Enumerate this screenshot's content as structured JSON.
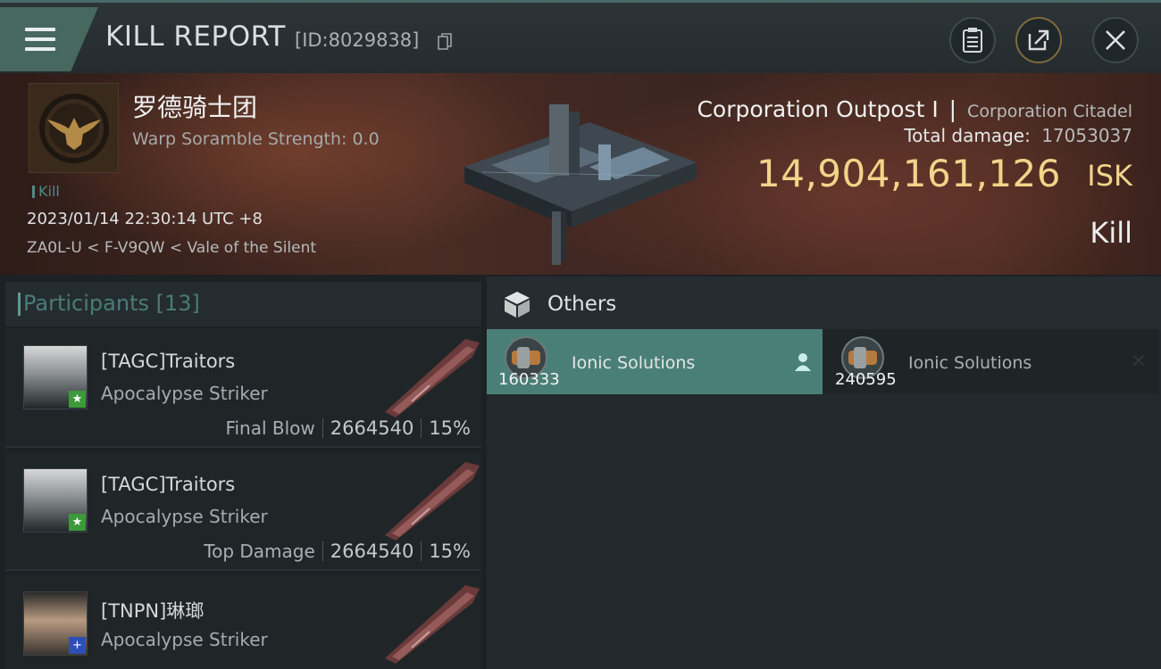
{
  "header": {
    "title": "KILL REPORT",
    "report_id": "[ID:8029838]"
  },
  "victim": {
    "corp_name": "罗德骑士团",
    "warp_scramble": "Warp Soramble Strength: 0.0",
    "tag": "Kill",
    "datetime": "2023/01/14 22:30:14 UTC +8",
    "location": "ZA0L-U < F-V9QW < Vale of the Silent",
    "target_name": "Corporation Outpost I",
    "target_type": "Corporation Citadel",
    "total_damage_label": "Total damage:",
    "total_damage_value": "17053037",
    "isk_value": "14,904,161,126",
    "isk_unit": "ISK",
    "kill_type": "Kill"
  },
  "participants": {
    "label": "Participants [13]",
    "rows": [
      {
        "name": "[TAGC]Traitors",
        "ship": "Apocalypse Striker",
        "role": "Final Blow",
        "damage": "2664540",
        "percent": "15%",
        "badge": "star"
      },
      {
        "name": "[TAGC]Traitors",
        "ship": "Apocalypse Striker",
        "role": "Top Damage",
        "damage": "2664540",
        "percent": "15%",
        "badge": "star"
      },
      {
        "name": "[TNPN]琳瑯",
        "ship": "Apocalypse Striker",
        "role": "",
        "damage": "",
        "percent": "",
        "badge": "plus"
      }
    ]
  },
  "others": {
    "label": "Others",
    "items": [
      {
        "name": "Ionic Solutions",
        "qty": "160333"
      },
      {
        "name": "Ionic Solutions",
        "qty": "240595"
      }
    ]
  },
  "colors": {
    "accent_teal": "#4a7f78",
    "isk_gold": "#f2d48a",
    "header_bg": "#2c3437"
  },
  "icons": [
    "menu-icon",
    "copy-icon",
    "clipboard-icon",
    "share-icon",
    "close-icon",
    "cube-icon",
    "person-icon",
    "star-badge-icon",
    "plus-badge-icon"
  ]
}
